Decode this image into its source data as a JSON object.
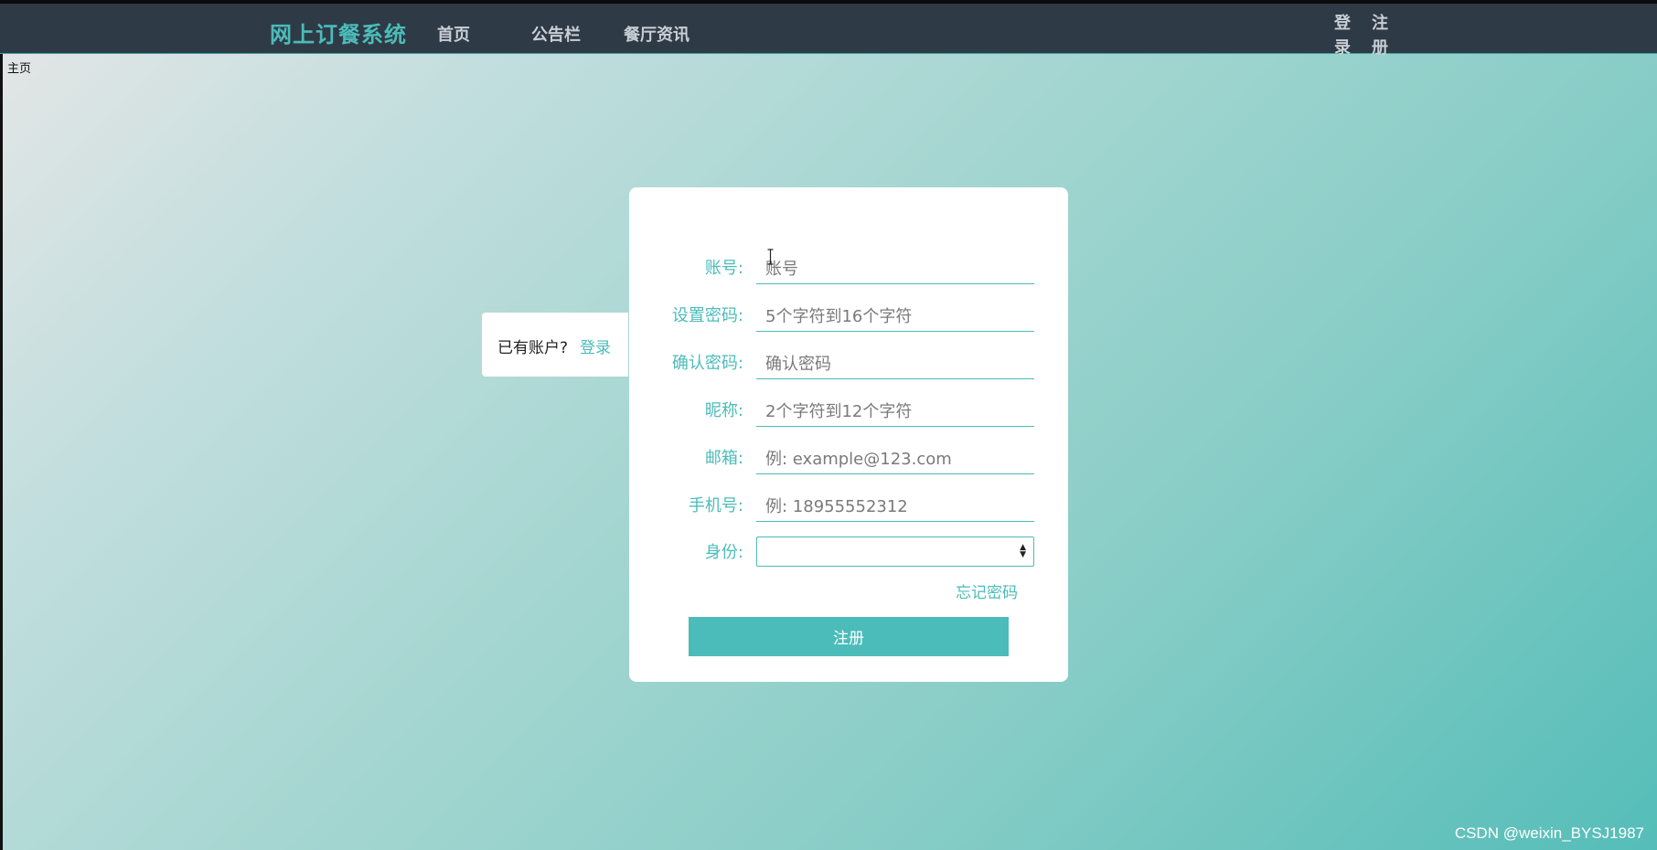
{
  "header": {
    "brand": "网上订餐系统",
    "nav": [
      "首页",
      "公告栏",
      "餐厅资讯"
    ],
    "login_label": "登录",
    "register_label": "注册"
  },
  "corner_text": "主页",
  "side_panel": {
    "question": "已有账户?",
    "login_link": "登录"
  },
  "form": {
    "fields": [
      {
        "label": "账号:",
        "placeholder": "账号",
        "value": ""
      },
      {
        "label": "设置密码:",
        "placeholder": "5个字符到16个字符",
        "value": ""
      },
      {
        "label": "确认密码:",
        "placeholder": "确认密码",
        "value": ""
      },
      {
        "label": "昵称:",
        "placeholder": "2个字符到12个字符",
        "value": ""
      },
      {
        "label": "邮箱:",
        "placeholder": "例: example@123.com",
        "value": ""
      },
      {
        "label": "手机号:",
        "placeholder": "例: 18955552312",
        "value": ""
      }
    ],
    "role": {
      "label": "身份:",
      "selected": ""
    },
    "forgot_password": "忘记密码",
    "submit_label": "注册"
  },
  "watermark": "CSDN @weixin_BYSJ1987",
  "colors": {
    "accent": "#4bbcb9",
    "navbar": "#2f3a47",
    "nav_text": "#c9ced4"
  },
  "icons": {
    "text_cursor": "text-cursor-icon",
    "select_arrows": "chevron-updown-icon"
  }
}
